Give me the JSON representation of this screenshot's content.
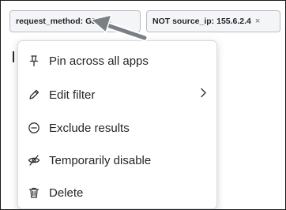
{
  "filters": [
    {
      "label": "request_method: GET",
      "close": "×"
    },
    {
      "label": "NOT source_ip: 155.6.2.4",
      "close": "×"
    }
  ],
  "menu": {
    "items": [
      {
        "label": "Pin across all apps",
        "icon": "pin-icon"
      },
      {
        "label": "Edit filter",
        "icon": "pencil-icon",
        "submenu": true
      },
      {
        "label": "Exclude results",
        "icon": "minus-circle-icon"
      },
      {
        "label": "Temporarily disable",
        "icon": "eye-slash-icon"
      },
      {
        "label": "Delete",
        "icon": "trash-icon"
      }
    ]
  },
  "colors": {
    "annotation_arrow": "#7a7e85",
    "pill_bg": "#f4f5f7",
    "pill_border": "#b8bcc3"
  }
}
